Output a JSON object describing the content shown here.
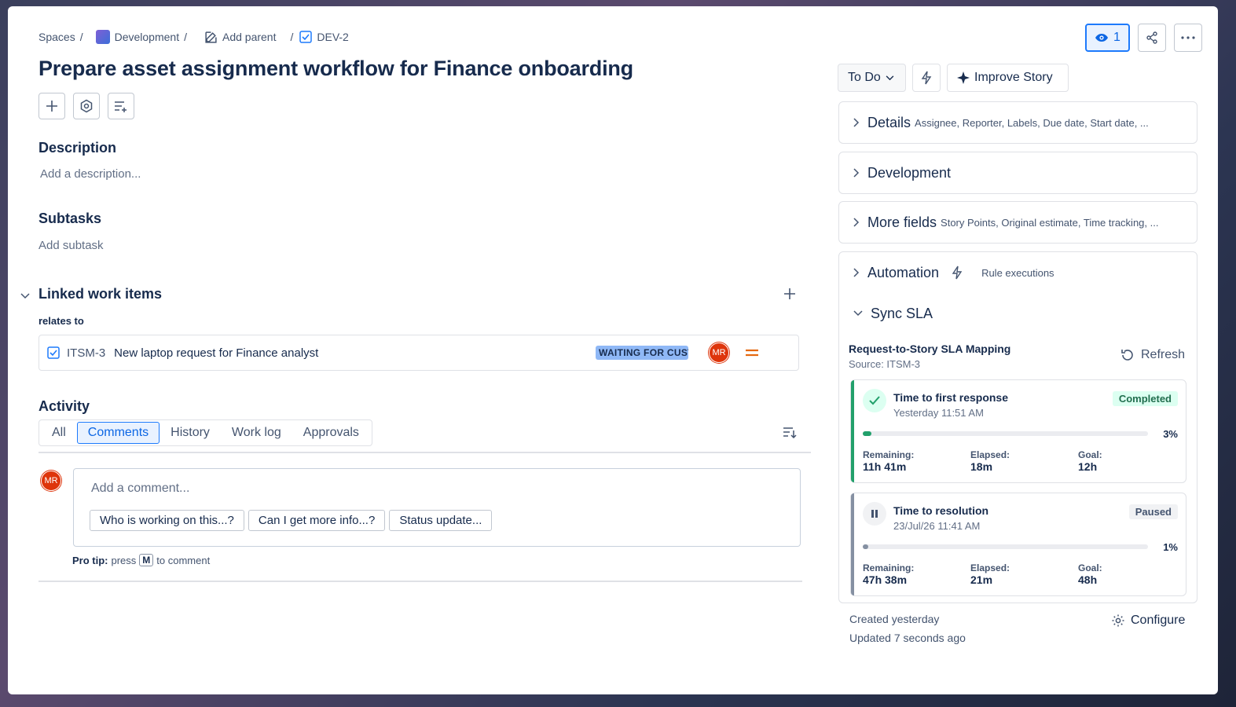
{
  "breadcrumb": {
    "spaces": "Spaces",
    "space": "Development",
    "add_parent": "Add parent",
    "issue_key": "DEV-2"
  },
  "title": "Prepare asset assignment workflow for Finance onboarding",
  "description": {
    "heading": "Description",
    "placeholder": "Add a description..."
  },
  "subtasks": {
    "heading": "Subtasks",
    "add": "Add subtask"
  },
  "linked": {
    "heading": "Linked work items",
    "relation": "relates to",
    "item": {
      "key": "ITSM-3",
      "summary": "New laptop request for Finance analyst",
      "status": "WAITING FOR CUSTOMER",
      "assignee_initials": "MR"
    }
  },
  "activity": {
    "heading": "Activity",
    "tabs": [
      "All",
      "Comments",
      "History",
      "Work log",
      "Approvals"
    ],
    "active_tab": "Comments",
    "user_initials": "MR",
    "comment_placeholder": "Add a comment...",
    "chips": [
      "Who is working on this...?",
      "Can I get more info...?",
      "Status update..."
    ],
    "pro_tip_label": "Pro tip:",
    "pro_tip_pre": "press",
    "pro_tip_key": "M",
    "pro_tip_post": "to comment"
  },
  "header_actions": {
    "watchers": "1"
  },
  "status_button": "To Do",
  "improve_button": "Improve Story",
  "panels": {
    "details": {
      "label": "Details",
      "sub": "Assignee, Reporter, Labels, Due date, Start date, ..."
    },
    "development": {
      "label": "Development"
    },
    "more_fields": {
      "label": "More fields",
      "sub": "Story Points, Original estimate, Time tracking, ..."
    },
    "automation": {
      "label": "Automation",
      "sub": "Rule executions"
    },
    "sync_sla": {
      "label": "Sync SLA"
    }
  },
  "sla": {
    "mapping_title": "Request-to-Story SLA Mapping",
    "source": "Source: ITSM-3",
    "refresh": "Refresh",
    "cards": [
      {
        "name": "Time to first response",
        "time": "Yesterday 11:51 AM",
        "badge": "Completed",
        "progress_pct": 3,
        "progress_label": "3%",
        "remaining_label": "Remaining:",
        "remaining": "11h 41m",
        "elapsed_label": "Elapsed:",
        "elapsed": "18m",
        "goal_label": "Goal:",
        "goal": "12h",
        "accent": "#22a06b"
      },
      {
        "name": "Time to resolution",
        "time": "23/Jul/26 11:41 AM",
        "badge": "Paused",
        "progress_pct": 1,
        "progress_label": "1%",
        "remaining_label": "Remaining:",
        "remaining": "47h 38m",
        "elapsed_label": "Elapsed:",
        "elapsed": "21m",
        "goal_label": "Goal:",
        "goal": "48h",
        "accent": "#8590a2"
      }
    ]
  },
  "footer": {
    "created": "Created yesterday",
    "updated": "Updated 7 seconds ago",
    "configure": "Configure"
  }
}
